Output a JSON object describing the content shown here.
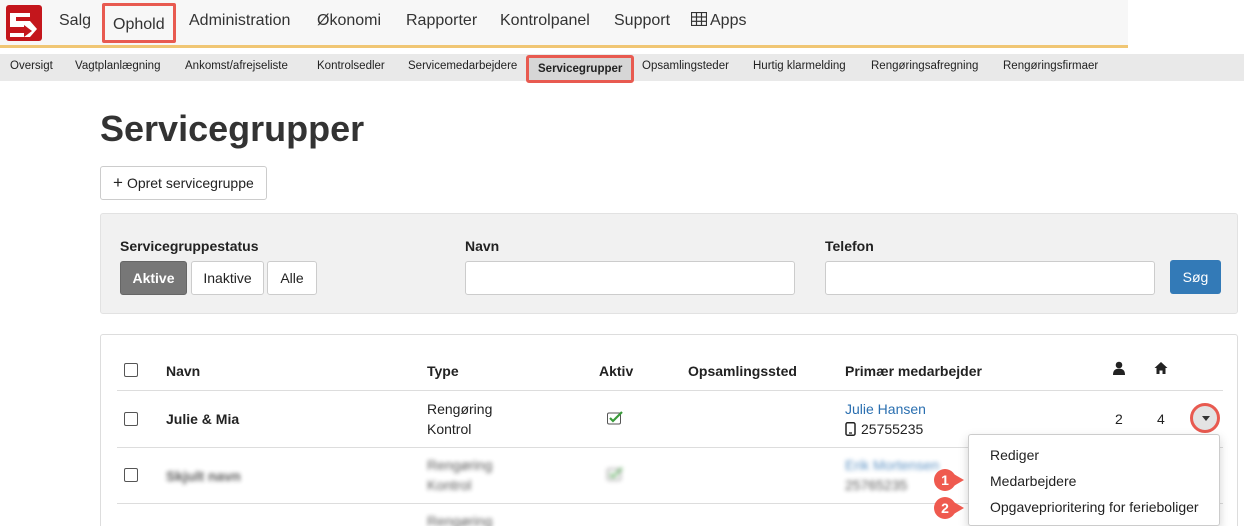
{
  "topnav": {
    "items": [
      {
        "label": "Salg"
      },
      {
        "label": "Ophold"
      },
      {
        "label": "Administration"
      },
      {
        "label": "Økonomi"
      },
      {
        "label": "Rapporter"
      },
      {
        "label": "Kontrolpanel"
      },
      {
        "label": "Support"
      },
      {
        "label": "Apps"
      }
    ],
    "active": "Ophold"
  },
  "subnav": {
    "items": [
      {
        "label": "Oversigt"
      },
      {
        "label": "Vagtplanlægning"
      },
      {
        "label": "Ankomst/afrejseliste"
      },
      {
        "label": "Kontrolsedler"
      },
      {
        "label": "Servicemedarbejdere"
      },
      {
        "label": "Servicegrupper"
      },
      {
        "label": "Opsamlingsteder"
      },
      {
        "label": "Hurtig klarmelding"
      },
      {
        "label": "Rengøringsafregning"
      },
      {
        "label": "Rengøringsfirmaer"
      }
    ],
    "active": "Servicegrupper"
  },
  "page": {
    "title": "Servicegrupper",
    "create_button": "Opret servicegruppe"
  },
  "filters": {
    "status_label": "Servicegruppestatus",
    "status_options": [
      "Aktive",
      "Inaktive",
      "Alle"
    ],
    "status_selected": "Aktive",
    "name_label": "Navn",
    "name_value": "",
    "phone_label": "Telefon",
    "phone_value": "",
    "search_button": "Søg"
  },
  "table": {
    "headers": {
      "name": "Navn",
      "type": "Type",
      "active": "Aktiv",
      "pickup": "Opsamlingssted",
      "primary": "Primær medarbejder",
      "staff_icon": "user-icon",
      "house_icon": "home-icon"
    },
    "rows": [
      {
        "name": "Julie & Mia",
        "type_lines": [
          "Rengøring",
          "Kontrol"
        ],
        "active": true,
        "pickup": "",
        "employee": "Julie Hansen",
        "phone": "25755235",
        "staff_count": "2",
        "house_count": "4"
      },
      {
        "name": "Skjult navn",
        "type_lines": [
          "Rengøring",
          "Kontrol"
        ],
        "active": true,
        "pickup": "",
        "employee": "Erik Mortensen",
        "phone": "25765235",
        "staff_count": "",
        "house_count": ""
      },
      {
        "name": "",
        "type_lines": [
          "Rengøring"
        ],
        "active": false,
        "pickup": "",
        "employee": "",
        "phone": "",
        "staff_count": "",
        "house_count": ""
      }
    ]
  },
  "dropdown": {
    "items": [
      "Rediger",
      "Medarbejdere",
      "Opgaveprioritering for ferieboliger"
    ]
  },
  "markers": [
    "1",
    "2"
  ],
  "colors": {
    "brand_red": "#c4161c",
    "highlight_red": "#e85a50",
    "primary_blue": "#337ab7",
    "link_blue": "#2a6fb0",
    "check_green": "#3a9a3a"
  }
}
